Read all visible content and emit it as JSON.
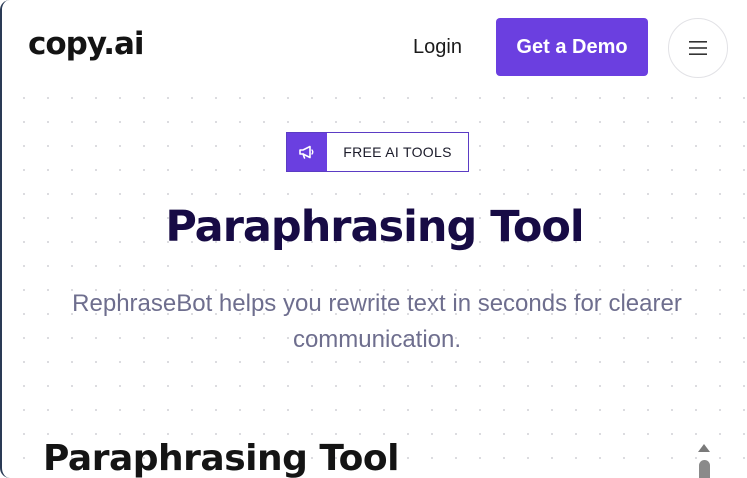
{
  "header": {
    "logo_text": "copy.ai",
    "login_label": "Login",
    "demo_label": "Get a Demo",
    "menu_icon": "hamburger-icon"
  },
  "hero": {
    "badge_icon": "megaphone-icon",
    "badge_label": "FREE AI TOOLS",
    "title": "Paraphrasing Tool",
    "subtitle": "RephraseBot helps you rewrite text in seconds for clearer communication."
  },
  "section": {
    "title": "Paraphrasing Tool"
  },
  "colors": {
    "accent": "#6b3fe0",
    "title": "#170b45",
    "subtitle": "#6e6e8e"
  }
}
